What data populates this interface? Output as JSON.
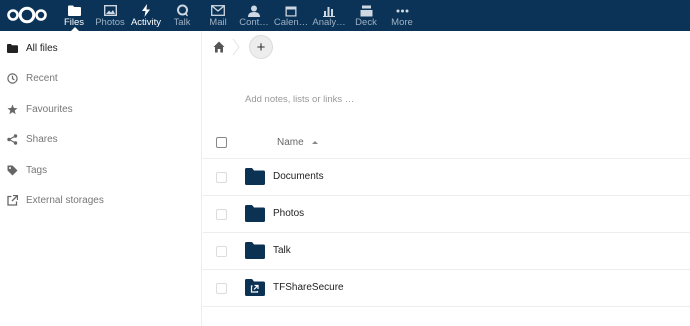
{
  "header": {
    "apps": [
      {
        "label": "Files",
        "icon": "folder-icon",
        "active": true
      },
      {
        "label": "Photos",
        "icon": "image-icon",
        "active": false
      },
      {
        "label": "Activity",
        "icon": "lightning-icon",
        "active": false
      },
      {
        "label": "Talk",
        "icon": "talk-icon",
        "active": false
      },
      {
        "label": "Mail",
        "icon": "mail-icon",
        "active": false
      },
      {
        "label": "Cont…",
        "icon": "contacts-icon",
        "active": false
      },
      {
        "label": "Calen…",
        "icon": "calendar-icon",
        "active": false
      },
      {
        "label": "Analy…",
        "icon": "analytics-icon",
        "active": false
      },
      {
        "label": "Deck",
        "icon": "deck-icon",
        "active": false
      },
      {
        "label": "More",
        "icon": "more-icon",
        "active": false
      }
    ],
    "bg_color": "#0a3357"
  },
  "sidebar": {
    "items": [
      {
        "label": "All files",
        "icon": "folder-icon",
        "active": true
      },
      {
        "label": "Recent",
        "icon": "clock-icon",
        "active": false
      },
      {
        "label": "Favourites",
        "icon": "star-icon",
        "active": false
      },
      {
        "label": "Shares",
        "icon": "share-icon",
        "active": false
      },
      {
        "label": "Tags",
        "icon": "tag-icon",
        "active": false
      },
      {
        "label": "External storages",
        "icon": "external-link-icon",
        "active": false
      }
    ]
  },
  "main": {
    "notes_placeholder": "Add notes, lists or links …",
    "add_button_label": "+",
    "table": {
      "name_header": "Name",
      "rows": [
        {
          "name": "Documents",
          "icon": "folder-icon"
        },
        {
          "name": "Photos",
          "icon": "folder-icon"
        },
        {
          "name": "Talk",
          "icon": "folder-icon"
        },
        {
          "name": "TFShareSecure",
          "icon": "shared-folder-icon"
        }
      ]
    }
  }
}
